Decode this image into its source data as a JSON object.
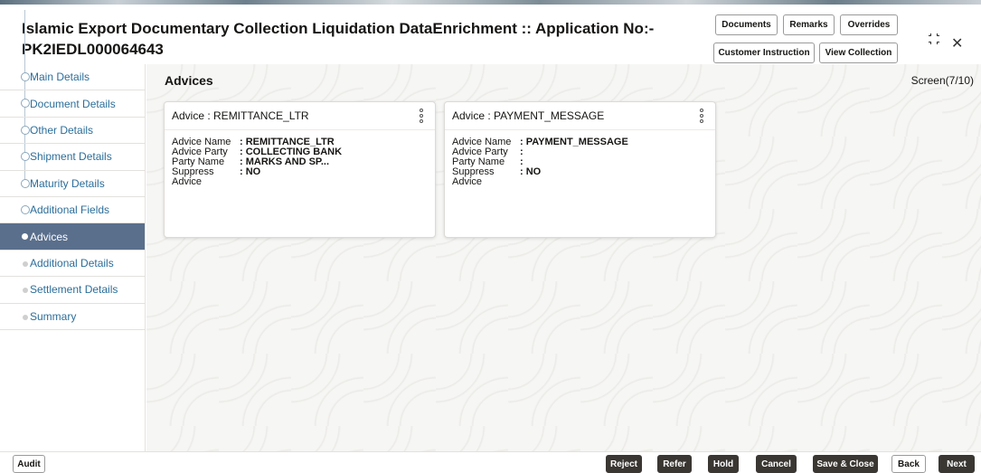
{
  "header": {
    "title": "Islamic Export Documentary Collection Liquidation DataEnrichment :: Application No:- PK2IEDL000064643",
    "buttons": {
      "documents": "Documents",
      "remarks": "Remarks",
      "overrides": "Overrides",
      "customer_instruction": "Customer Instruction",
      "view_collection": "View Collection"
    },
    "icons": {
      "expand": "expand-icon",
      "close": "close-icon"
    }
  },
  "sidebar": {
    "items": [
      {
        "label": "Main Details",
        "state": "done"
      },
      {
        "label": "Document Details",
        "state": "done"
      },
      {
        "label": "Other Details",
        "state": "done"
      },
      {
        "label": "Shipment Details",
        "state": "done"
      },
      {
        "label": "Maturity Details",
        "state": "done"
      },
      {
        "label": "Additional Fields",
        "state": "done"
      },
      {
        "label": "Advices",
        "state": "active"
      },
      {
        "label": "Additional Details",
        "state": "pending"
      },
      {
        "label": "Settlement Details",
        "state": "pending"
      },
      {
        "label": "Summary",
        "state": "pending"
      }
    ]
  },
  "main": {
    "section_title": "Advices",
    "screen_label": "Screen(7/10)",
    "cards": [
      {
        "title": "Advice : REMITTANCE_LTR",
        "fields": [
          {
            "label": "Advice Name",
            "value": ": REMITTANCE_LTR"
          },
          {
            "label": "Advice Party",
            "value": ": COLLECTING BANK"
          },
          {
            "label": "Party Name",
            "value": ": MARKS AND SP..."
          },
          {
            "label": "Suppress Advice",
            "value": ": NO"
          }
        ]
      },
      {
        "title": "Advice : PAYMENT_MESSAGE",
        "fields": [
          {
            "label": "Advice Name",
            "value": ": PAYMENT_MESSAGE"
          },
          {
            "label": "Advice Party",
            "value": ":"
          },
          {
            "label": "Party Name",
            "value": ":"
          },
          {
            "label": "Suppress Advice",
            "value": ": NO"
          }
        ]
      }
    ]
  },
  "footer": {
    "audit": "Audit",
    "reject": "Reject",
    "refer": "Refer",
    "hold": "Hold",
    "cancel": "Cancel",
    "save_close": "Save & Close",
    "back": "Back",
    "next": "Next"
  },
  "colors": {
    "active_nav_bg": "#5a6f8c",
    "link_text": "#2c6e9a",
    "dark_button": "#3a3632"
  }
}
